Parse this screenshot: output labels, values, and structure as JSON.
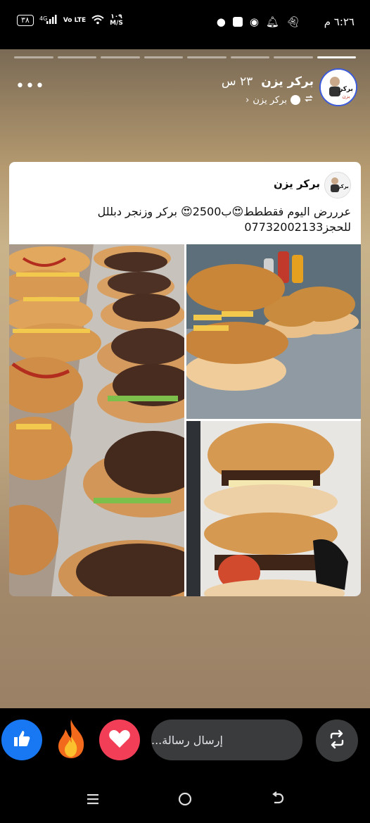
{
  "status_bar": {
    "time": "٦:٢٦ م",
    "battery": "٣٨",
    "network_type": "4G",
    "volte": "Vo LTE",
    "speed_value": "١٠٩",
    "speed_unit": "M/S"
  },
  "story": {
    "progress_total": 8,
    "progress_done": 1,
    "author_name": "بركر يزن",
    "time_ago": "٢٣ س",
    "shared_from": "بركر يزن"
  },
  "post": {
    "page_name": "بركر يزن",
    "text_line1": "عرررض اليوم فقططط😍ب2500😍 بركر وزنجر دبللل",
    "text_line2": "للحجز07732002133"
  },
  "bottom": {
    "message_placeholder": "إرسال رسالة...",
    "reactions": [
      "like",
      "fire",
      "love"
    ]
  },
  "colors": {
    "like": "#1877f2",
    "love": "#f33e58",
    "input_bg": "#3a3b3c"
  }
}
